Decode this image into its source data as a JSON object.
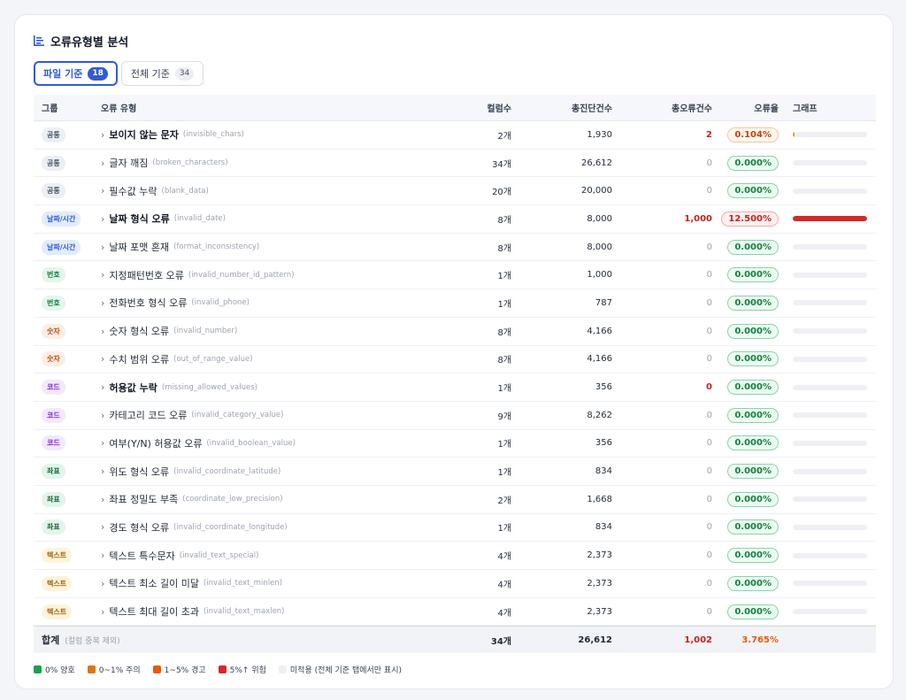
{
  "title": "오류유형별 분석",
  "tabs": [
    {
      "label": "파일 기준",
      "count": "18",
      "active": true
    },
    {
      "label": "전체 기준",
      "count": "34",
      "active": false
    }
  ],
  "headers": {
    "group": "그룹",
    "type": "오류 유형",
    "cols": "컬럼수",
    "total": "총진단건수",
    "errors": "총오류건수",
    "rate": "오류율",
    "graph": "그래프"
  },
  "group_colors": {
    "공통": {
      "bg": "#eceff3",
      "fg": "#475569"
    },
    "날짜/시간": {
      "bg": "#e3ebfd",
      "fg": "#2f5bd6"
    },
    "번호": {
      "bg": "#e5f6ec",
      "fg": "#15803d"
    },
    "숫자": {
      "bg": "#fdeee3",
      "fg": "#c2410c"
    },
    "코드": {
      "bg": "#f3e8fd",
      "fg": "#7e22ce"
    },
    "좌표": {
      "bg": "#e2f5ea",
      "fg": "#166534"
    },
    "텍스트": {
      "bg": "#fef4dc",
      "fg": "#a16207"
    }
  },
  "rows": [
    {
      "group": "공통",
      "name": "보이지 않는 문자",
      "code": "(invisible_chars)",
      "bold": true,
      "cols": "2개",
      "total": "1,930",
      "errors": "2",
      "rate": "0.104%",
      "level": "caution",
      "fill": 0.104
    },
    {
      "group": "공통",
      "name": "글자 깨짐",
      "code": "(broken_characters)",
      "bold": false,
      "cols": "34개",
      "total": "26,612",
      "errors": "0",
      "rate": "0.000%",
      "level": "good",
      "fill": 0
    },
    {
      "group": "공통",
      "name": "필수값 누락",
      "code": "(blank_data)",
      "bold": false,
      "cols": "20개",
      "total": "20,000",
      "errors": "0",
      "rate": "0.000%",
      "level": "good",
      "fill": 0
    },
    {
      "group": "날짜/시간",
      "name": "날짜 형식 오류",
      "code": "(invalid_date)",
      "bold": true,
      "cols": "8개",
      "total": "8,000",
      "errors": "1,000",
      "rate": "12.500%",
      "level": "danger",
      "fill": 12.5
    },
    {
      "group": "날짜/시간",
      "name": "날짜 포맷 혼재",
      "code": "(format_inconsistency)",
      "bold": false,
      "cols": "8개",
      "total": "8,000",
      "errors": "0",
      "rate": "0.000%",
      "level": "good",
      "fill": 0
    },
    {
      "group": "번호",
      "name": "지정패턴번호 오류",
      "code": "(invalid_number_id_pattern)",
      "bold": false,
      "cols": "1개",
      "total": "1,000",
      "errors": "0",
      "rate": "0.000%",
      "level": "good",
      "fill": 0
    },
    {
      "group": "번호",
      "name": "전화번호 형식 오류",
      "code": "(invalid_phone)",
      "bold": false,
      "cols": "1개",
      "total": "787",
      "errors": "0",
      "rate": "0.000%",
      "level": "good",
      "fill": 0
    },
    {
      "group": "숫자",
      "name": "숫자 형식 오류",
      "code": "(invalid_number)",
      "bold": false,
      "cols": "8개",
      "total": "4,166",
      "errors": "0",
      "rate": "0.000%",
      "level": "good",
      "fill": 0
    },
    {
      "group": "숫자",
      "name": "수치 범위 오류",
      "code": "(out_of_range_value)",
      "bold": false,
      "cols": "8개",
      "total": "4,166",
      "errors": "0",
      "rate": "0.000%",
      "level": "good",
      "fill": 0
    },
    {
      "group": "코드",
      "name": "허용값 누락",
      "code": "(missing_allowed_values)",
      "bold": true,
      "cols": "1개",
      "total": "356",
      "errors": "0",
      "rate": "0.000%",
      "level": "good",
      "fill": 0,
      "errHot": true
    },
    {
      "group": "코드",
      "name": "카테고리 코드 오류",
      "code": "(invalid_category_value)",
      "bold": false,
      "cols": "9개",
      "total": "8,262",
      "errors": "0",
      "rate": "0.000%",
      "level": "good",
      "fill": 0
    },
    {
      "group": "코드",
      "name": "여부(Y/N) 허용값 오류",
      "code": "(invalid_boolean_value)",
      "bold": false,
      "cols": "1개",
      "total": "356",
      "errors": "0",
      "rate": "0.000%",
      "level": "good",
      "fill": 0
    },
    {
      "group": "좌표",
      "name": "위도 형식 오류",
      "code": "(invalid_coordinate_latitude)",
      "bold": false,
      "cols": "1개",
      "total": "834",
      "errors": "0",
      "rate": "0.000%",
      "level": "good",
      "fill": 0
    },
    {
      "group": "좌표",
      "name": "좌표 정밀도 부족",
      "code": "(coordinate_low_precision)",
      "bold": false,
      "cols": "2개",
      "total": "1,668",
      "errors": "0",
      "rate": "0.000%",
      "level": "good",
      "fill": 0
    },
    {
      "group": "좌표",
      "name": "경도 형식 오류",
      "code": "(invalid_coordinate_longitude)",
      "bold": false,
      "cols": "1개",
      "total": "834",
      "errors": "0",
      "rate": "0.000%",
      "level": "good",
      "fill": 0
    },
    {
      "group": "텍스트",
      "name": "텍스트 특수문자",
      "code": "(invalid_text_special)",
      "bold": false,
      "cols": "4개",
      "total": "2,373",
      "errors": "0",
      "rate": "0.000%",
      "level": "good",
      "fill": 0
    },
    {
      "group": "텍스트",
      "name": "텍스트 최소 길이 미달",
      "code": "(invalid_text_minlen)",
      "bold": false,
      "cols": "4개",
      "total": "2,373",
      "errors": "0",
      "rate": "0.000%",
      "level": "good",
      "fill": 0
    },
    {
      "group": "텍스트",
      "name": "텍스트 최대 길이 초과",
      "code": "(invalid_text_maxlen)",
      "bold": false,
      "cols": "4개",
      "total": "2,373",
      "errors": "0",
      "rate": "0.000%",
      "level": "good",
      "fill": 0
    }
  ],
  "total": {
    "label": "합계",
    "note": "(컬럼 중복 제외)",
    "cols": "34개",
    "total": "26,612",
    "errors": "1,002",
    "rate": "3.765%"
  },
  "levels": {
    "good": {
      "fg": "#15803d",
      "bg": "#ecfdf3",
      "border": "#86d6a6",
      "bar": "#16a34a"
    },
    "caution": {
      "fg": "#c2410c",
      "bg": "#fff7ed",
      "border": "#f7c694",
      "bar": "#ea8a2e"
    },
    "warning": {
      "fg": "#ea580c",
      "bg": "#fff4ec",
      "border": "#f5b38a",
      "bar": "#ea580c"
    },
    "danger": {
      "fg": "#c81e1e",
      "bg": "#fdf0f0",
      "border": "#f2a9a9",
      "bar": "#d12b2b"
    }
  },
  "legend": [
    {
      "label": "0% 양호",
      "color": "#16a34a"
    },
    {
      "label": "0~1% 주의",
      "color": "#d97706"
    },
    {
      "label": "1~5% 경고",
      "color": "#ea580c"
    },
    {
      "label": "5%↑ 위험",
      "color": "#dc2626"
    },
    {
      "label": "미적용 (전체 기준 탭에서만 표시)",
      "color": "#eef0f4"
    }
  ],
  "total_rate_color": "#ea580c"
}
